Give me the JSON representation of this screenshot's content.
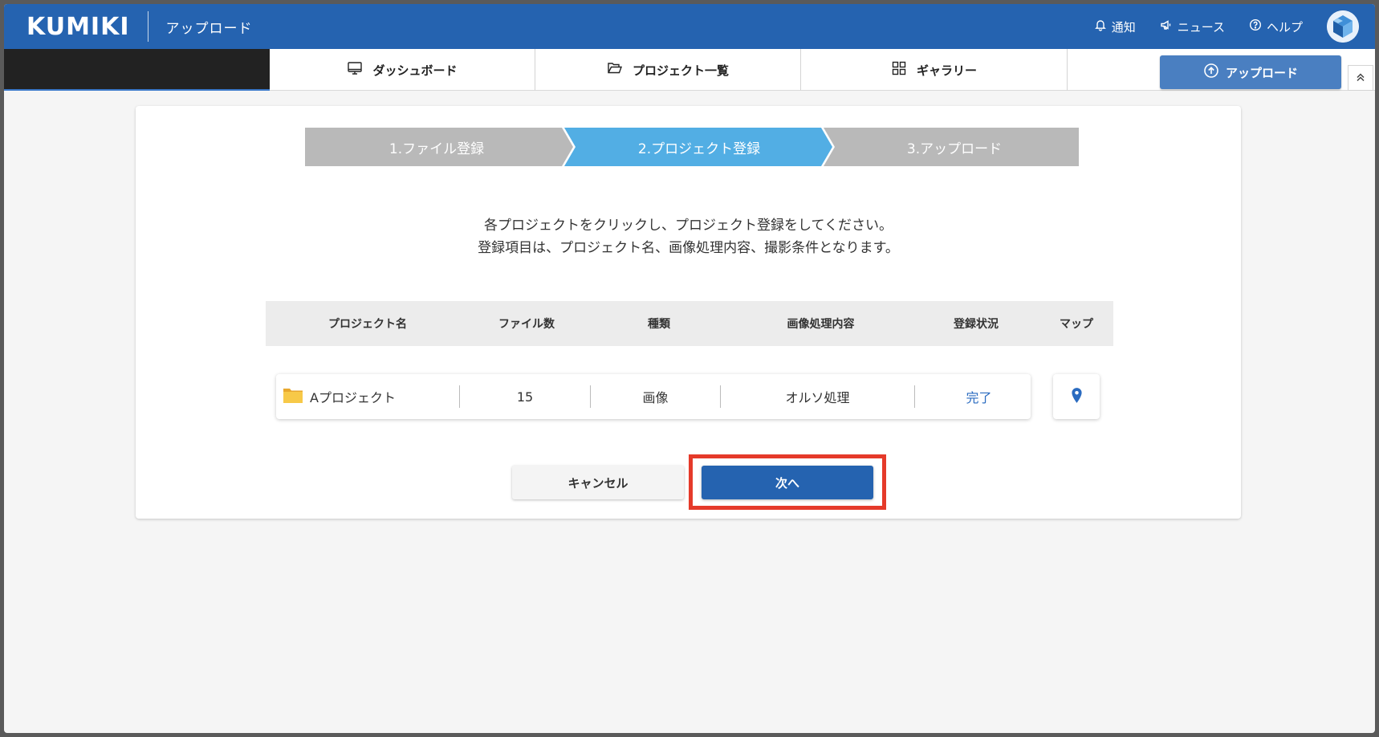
{
  "header": {
    "logo": "KUMIKI",
    "page_name": "アップロード",
    "notify_label": "通知",
    "news_label": "ニュース",
    "help_label": "ヘルプ"
  },
  "nav": {
    "tabs": [
      {
        "label": "ダッシュボード",
        "icon": "monitor-icon"
      },
      {
        "label": "プロジェクト一覧",
        "icon": "folder-open-icon"
      },
      {
        "label": "ギャラリー",
        "icon": "grid-icon"
      }
    ],
    "upload_label": "アップロード"
  },
  "stepper": {
    "steps": [
      {
        "label": "1.ファイル登録",
        "state": "done"
      },
      {
        "label": "2.プロジェクト登録",
        "state": "active"
      },
      {
        "label": "3.アップロード",
        "state": "pending"
      }
    ],
    "colors": {
      "active": "#52aee4",
      "inactive": "#b9b9b9"
    }
  },
  "instructions": {
    "line1": "各プロジェクトをクリックし、プロジェクト登録をしてください。",
    "line2": "登録項目は、プロジェクト名、画像処理内容、撮影条件となります。"
  },
  "table": {
    "columns": [
      "プロジェクト名",
      "ファイル数",
      "種類",
      "画像処理内容",
      "登録状況",
      "マップ"
    ],
    "rows": [
      {
        "name": "Aプロジェクト",
        "files": "15",
        "type": "画像",
        "processing": "オルソ処理",
        "status": "完了"
      }
    ]
  },
  "buttons": {
    "cancel": "キャンセル",
    "next": "次へ"
  },
  "colors": {
    "brand": "#2563b0",
    "highlight": "#e53a2a",
    "status_link": "#2a6bc0"
  }
}
